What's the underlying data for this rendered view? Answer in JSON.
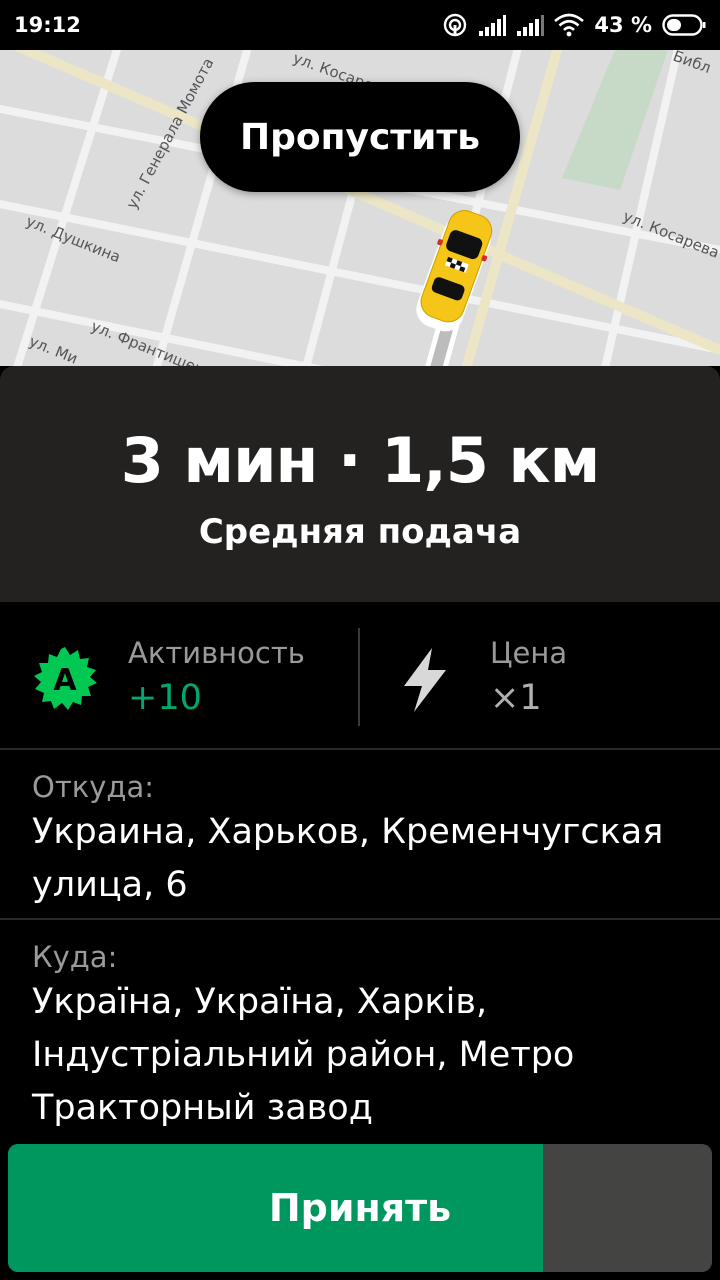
{
  "status_bar": {
    "time": "19:12",
    "battery": "43 %"
  },
  "map": {
    "streets": [
      "ул. Генерала Момота",
      "ул. Косарева",
      "ул. Душкина",
      "ул. Франтишека Крала",
      "ул. Ми",
      "Библ",
      "ул. Косарева"
    ]
  },
  "skip_button": {
    "label": "Пропустить"
  },
  "order": {
    "eta": "3 мин · 1,5 км",
    "supply": "Средняя подача"
  },
  "stats": {
    "activity": {
      "badge": "A",
      "label": "Активность",
      "value": "+10"
    },
    "price": {
      "label": "Цена",
      "value": "×1"
    }
  },
  "route": {
    "from_label": "Откуда:",
    "from_address": "Украина, Харьков, Кременчугская улица, 6",
    "to_label": "Куда:",
    "to_address": "Україна, Україна, Харків, Індустріальний район, Метро Тракторный завод"
  },
  "accept_button": {
    "label": "Принять",
    "progress": 0.76
  },
  "colors": {
    "accent_green": "#00975f",
    "activity_badge": "#00c853",
    "panel_dark": "#232221",
    "taxi_yellow": "#f5c518"
  }
}
